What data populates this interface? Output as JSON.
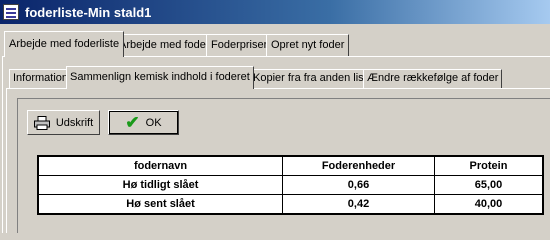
{
  "window": {
    "title": "foderliste-Min stald1"
  },
  "main_tabs": [
    {
      "label": "Arbejde med foderliste"
    },
    {
      "label": "Arbejde med foder"
    },
    {
      "label": "Foderpriser"
    },
    {
      "label": "Opret nyt foder"
    }
  ],
  "sub_tabs": [
    {
      "label": "Information"
    },
    {
      "label": "Sammenlign kemisk indhold i foderet"
    },
    {
      "label": "Kopier fra fra anden liste"
    },
    {
      "label": "Ændre rækkefølge af foder"
    }
  ],
  "buttons": {
    "print_label": "Udskrift",
    "ok_label": "OK"
  },
  "table": {
    "headers": [
      "fodernavn",
      "Foderenheder",
      "Protein"
    ],
    "rows": [
      [
        "Hø tidligt slået",
        "0,66",
        "65,00"
      ],
      [
        "Hø sent slået",
        "0,42",
        "40,00"
      ]
    ]
  },
  "icons": {
    "app": "app-list-icon",
    "print": "printer-icon",
    "ok": "checkmark-icon"
  },
  "colors": {
    "titlebar": "#0a246a",
    "face": "#d4d0c8",
    "check": "#1a9a1a"
  }
}
